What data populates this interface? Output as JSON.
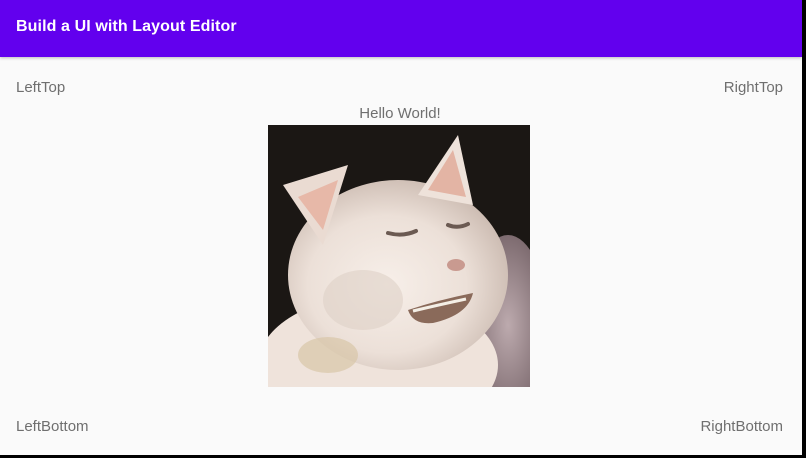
{
  "appbar": {
    "title": "Build a UI with Layout Editor",
    "color": "#6200ee"
  },
  "labels": {
    "left_top": "LeftTop",
    "right_top": "RightTop",
    "center": "Hello World!",
    "left_bottom": "LeftBottom",
    "right_bottom": "RightBottom"
  },
  "image": {
    "subject": "white cat photo"
  }
}
